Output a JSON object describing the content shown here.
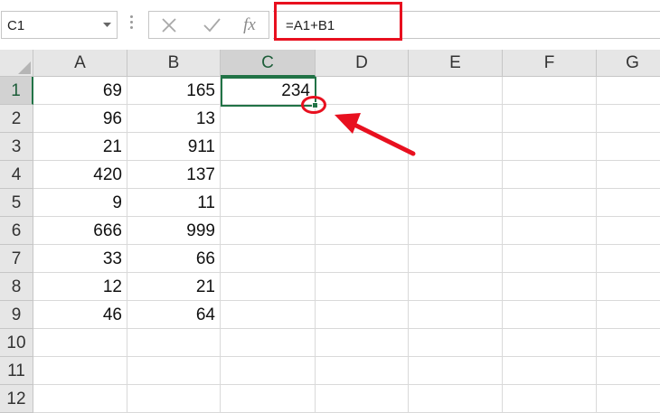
{
  "formula_bar": {
    "name_box": "C1",
    "formula": "=A1+B1",
    "fx_label": "fx"
  },
  "columns": [
    "A",
    "B",
    "C",
    "D",
    "E",
    "F",
    "G"
  ],
  "rows": [
    "1",
    "2",
    "3",
    "4",
    "5",
    "6",
    "7",
    "8",
    "9",
    "10",
    "11",
    "12"
  ],
  "cells": {
    "A": [
      "69",
      "96",
      "21",
      "420",
      "9",
      "666",
      "33",
      "12",
      "46",
      "",
      "",
      ""
    ],
    "B": [
      "165",
      "13",
      "911",
      "137",
      "11",
      "999",
      "66",
      "21",
      "64",
      "",
      "",
      ""
    ],
    "C": [
      "234",
      "",
      "",
      "",
      "",
      "",
      "",
      "",
      "",
      "",
      "",
      ""
    ]
  },
  "selected_cell": "C1",
  "annotation_color": "#e8101f",
  "selection_color": "#217346"
}
